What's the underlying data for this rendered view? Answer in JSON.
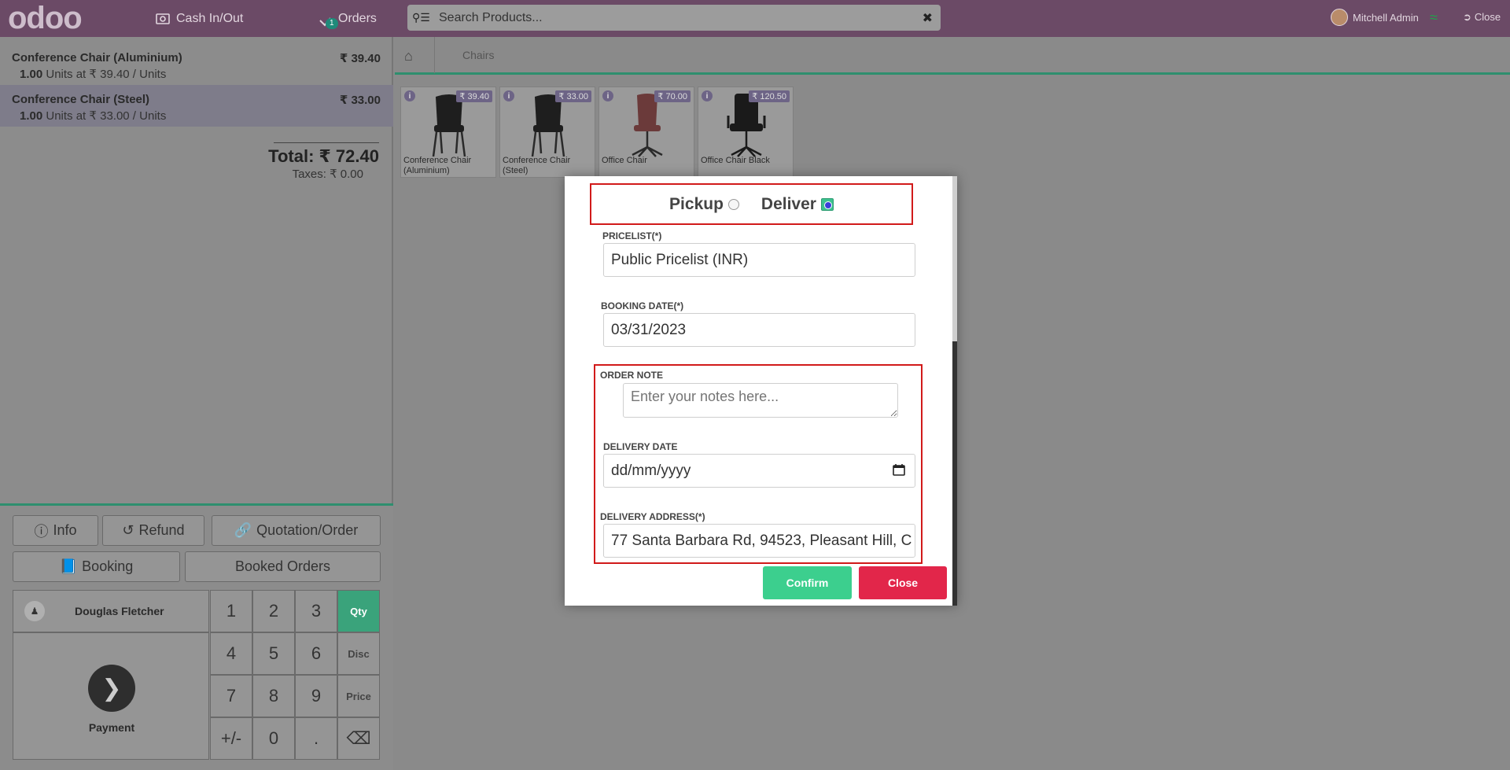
{
  "header": {
    "logo_text": "odoo",
    "cash_label": "Cash In/Out",
    "orders_label": "Orders",
    "orders_count": "1",
    "search_placeholder": "Search Products...",
    "user_name": "Mitchell Admin",
    "close_label": "Close",
    "colors": {
      "topbar": "#6b4a66",
      "accent": "#2e8f6e"
    }
  },
  "order": {
    "lines": [
      {
        "name": "Conference Chair (Aluminium)",
        "price": "₹ 39.40",
        "qty": "1.00",
        "info": "Units at ₹ 39.40 / Units"
      },
      {
        "name": "Conference Chair (Steel)",
        "price": "₹ 33.00",
        "qty": "1.00",
        "info": "Units at ₹ 33.00 / Units"
      }
    ],
    "total": "Total: ₹ 72.40",
    "taxes": "Taxes: ₹ 0.00"
  },
  "controls": {
    "info_label": "Info",
    "refund_label": "Refund",
    "quotation_label": "Quotation/Order",
    "booking_label": "Booking",
    "booked_orders_label": "Booked Orders",
    "customer_name": "Douglas Fletcher",
    "payment_label": "Payment",
    "keys": [
      "1",
      "2",
      "3",
      "4",
      "5",
      "6",
      "7",
      "8",
      "9",
      "+/-",
      "0",
      "."
    ],
    "mode_qty": "Qty",
    "mode_disc": "Disc",
    "mode_price": "Price"
  },
  "products": {
    "category": "Chairs",
    "items": [
      {
        "name": "Conference Chair (Aluminium)",
        "price": "₹ 39.40"
      },
      {
        "name": "Conference Chair (Steel)",
        "price": "₹ 33.00"
      },
      {
        "name": "Office Chair",
        "price": "₹ 70.00"
      },
      {
        "name": "Office Chair Black",
        "price": "₹ 120.50"
      }
    ]
  },
  "modal": {
    "pickup_label": "Pickup",
    "deliver_label": "Deliver",
    "selected_mode": "Deliver",
    "pricelist_label": "PRICELIST(*)",
    "pricelist_value": "Public Pricelist (INR)",
    "booking_date_label": "BOOKING DATE(*)",
    "booking_date_value": "03/31/2023",
    "order_note_label": "ORDER NOTE",
    "order_note_placeholder": "Enter your notes here...",
    "delivery_date_label": "DELIVERY DATE",
    "delivery_date_placeholder": "dd/mm/yyyy",
    "delivery_address_label": "DELIVERY ADDRESS(*)",
    "delivery_address_value": "77 Santa Barbara Rd, 94523, Pleasant Hill, C",
    "confirm_label": "Confirm",
    "close_label": "Close",
    "colors": {
      "confirm": "#3ccf8e",
      "close": "#e2264a",
      "highlight": "#d11a1a"
    }
  }
}
